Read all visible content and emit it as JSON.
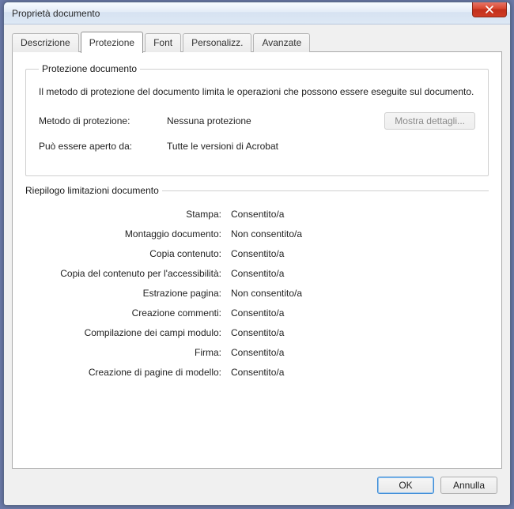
{
  "window": {
    "title": "Proprietà documento"
  },
  "tabs": [
    {
      "label": "Descrizione"
    },
    {
      "label": "Protezione"
    },
    {
      "label": "Font"
    },
    {
      "label": "Personalizz."
    },
    {
      "label": "Avanzate"
    }
  ],
  "protection_group": {
    "legend": "Protezione documento",
    "description": "Il metodo di protezione del documento limita le operazioni che possono essere eseguite sul documento.",
    "method_label": "Metodo di protezione:",
    "method_value": "Nessuna protezione",
    "open_label": "Può essere aperto da:",
    "open_value": "Tutte le versioni di Acrobat",
    "details_button": "Mostra dettagli..."
  },
  "summary": {
    "legend": "Riepilogo limitazioni documento",
    "rows": [
      {
        "label": "Stampa:",
        "value": "Consentito/a"
      },
      {
        "label": "Montaggio documento:",
        "value": "Non consentito/a"
      },
      {
        "label": "Copia contenuto:",
        "value": "Consentito/a"
      },
      {
        "label": "Copia del contenuto per l'accessibilità:",
        "value": "Consentito/a"
      },
      {
        "label": "Estrazione pagina:",
        "value": "Non consentito/a"
      },
      {
        "label": "Creazione commenti:",
        "value": "Consentito/a"
      },
      {
        "label": "Compilazione dei campi modulo:",
        "value": "Consentito/a"
      },
      {
        "label": "Firma:",
        "value": "Consentito/a"
      },
      {
        "label": "Creazione di pagine di modello:",
        "value": "Consentito/a"
      }
    ]
  },
  "footer": {
    "ok": "OK",
    "cancel": "Annulla"
  }
}
